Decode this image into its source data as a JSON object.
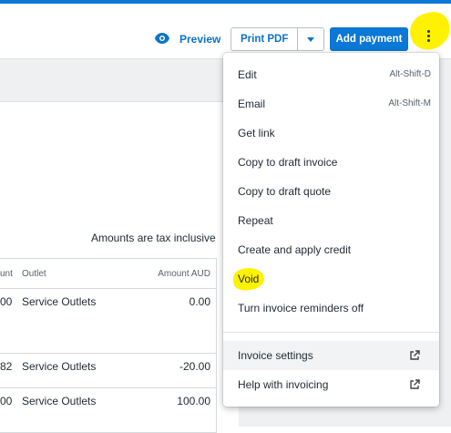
{
  "toolbar": {
    "preview_label": "Preview",
    "print_pdf_label": "Print PDF",
    "add_payment_label": "Add payment"
  },
  "content": {
    "amounts_note": "Amounts are tax inclusive",
    "table": {
      "headers": {
        "col1": "unt",
        "outlet": "Outlet",
        "amount": "Amount AUD"
      },
      "rows": [
        {
          "col1": "00",
          "outlet": "Service Outlets",
          "amount": "0.00"
        },
        {
          "col1": "82",
          "outlet": "Service Outlets",
          "amount": "-20.00"
        },
        {
          "col1": "00",
          "outlet": "Service Outlets",
          "amount": "100.00"
        }
      ]
    }
  },
  "menu": {
    "items": [
      {
        "label": "Edit",
        "shortcut": "Alt-Shift-D"
      },
      {
        "label": "Email",
        "shortcut": "Alt-Shift-M"
      },
      {
        "label": "Get link"
      },
      {
        "label": "Copy to draft invoice"
      },
      {
        "label": "Copy to draft quote"
      },
      {
        "label": "Repeat"
      },
      {
        "label": "Create and apply credit"
      },
      {
        "label": "Void"
      },
      {
        "label": "Turn invoice reminders off"
      }
    ],
    "footer_items": [
      {
        "label": "Invoice settings",
        "icon": "external-link-icon"
      },
      {
        "label": "Help with invoicing",
        "icon": "external-link-icon"
      }
    ]
  },
  "colors": {
    "accent": "#0b77d6",
    "highlight": "#fff200"
  }
}
